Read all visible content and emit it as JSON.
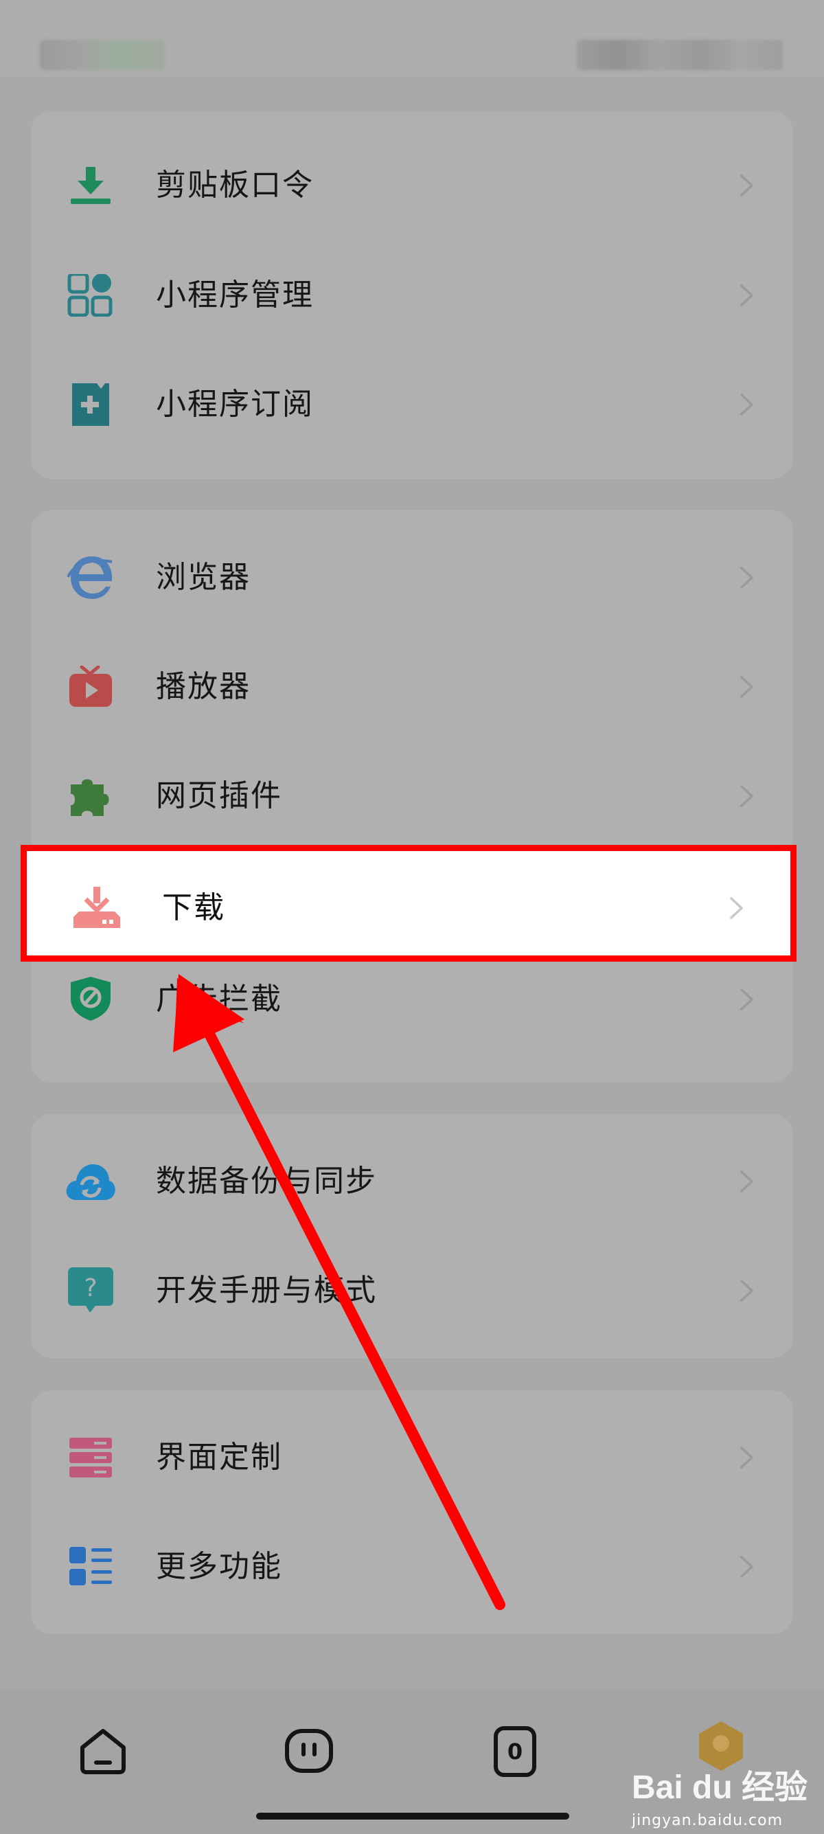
{
  "sections": [
    {
      "items": [
        {
          "label": "剪贴板口令",
          "icon": "clipboard-download-icon",
          "color": "#1f8a5a"
        },
        {
          "label": "小程序管理",
          "icon": "apps-grid-icon",
          "color": "#2a7f86"
        },
        {
          "label": "小程序订阅",
          "icon": "bookmark-plus-icon",
          "color": "#25737a"
        }
      ]
    },
    {
      "items": [
        {
          "label": "浏览器",
          "icon": "browser-e-icon",
          "color": "#4f7fb8"
        },
        {
          "label": "播放器",
          "icon": "tv-play-icon",
          "color": "#b94b4b"
        },
        {
          "label": "网页插件",
          "icon": "puzzle-icon",
          "color": "#3e7a3a"
        },
        {
          "label": "下载",
          "icon": "download-icon",
          "color": "#f38a8a"
        },
        {
          "label": "广告拦截",
          "icon": "shield-block-icon",
          "color": "#138a5a"
        }
      ]
    },
    {
      "items": [
        {
          "label": "数据备份与同步",
          "icon": "cloud-sync-icon",
          "color": "#1e88c8"
        },
        {
          "label": "开发手册与模式",
          "icon": "help-bubble-icon",
          "color": "#2a8a8c"
        }
      ]
    },
    {
      "items": [
        {
          "label": "界面定制",
          "icon": "layout-icon",
          "color": "#c0597c"
        },
        {
          "label": "更多功能",
          "icon": "list-icon",
          "color": "#2c6fbe"
        }
      ]
    }
  ],
  "highlighted_label": "下载",
  "nav": {
    "items": [
      "home-icon",
      "face-icon",
      "tabs-counter-icon",
      "profile-avatar-icon"
    ],
    "tabs_count": "0"
  },
  "watermark": {
    "text": "Bai du 经验",
    "sub": "jingyan.baidu.com"
  },
  "colors": {
    "highlight_border": "#ff0000",
    "arrow": "#ff0000"
  }
}
